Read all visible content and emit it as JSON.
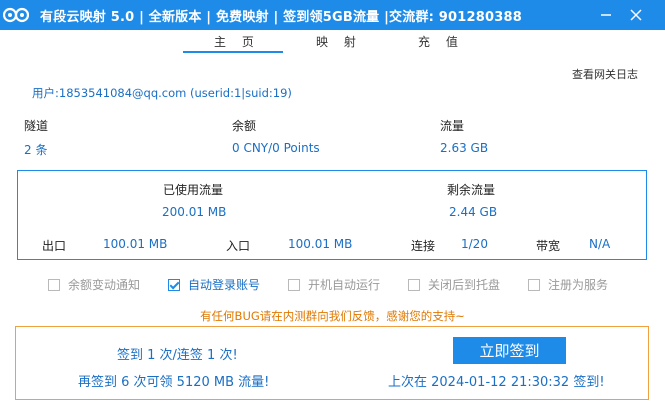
{
  "window": {
    "title": "有段云映射 5.0 | 全新版本 | 免费映射 | 签到领5GB流量 |交流群: 901280388",
    "minimize_icon": "minimize-icon",
    "close_icon": "close-icon",
    "logo_icon": "owl-logo-icon"
  },
  "tabs": [
    "主 页",
    "映 射",
    "充 值"
  ],
  "active_tab": "主 页",
  "header": {
    "log_link": "查看网关日志",
    "user_line": "用户:1853541084@qq.com (userid:1|suid:19)"
  },
  "stats": {
    "tunnels_label": "隧道",
    "tunnels_value": "2 条",
    "balance_label": "余额",
    "balance_value": "0 CNY/0 Points",
    "traffic_label": "流量",
    "traffic_value": "2.63 GB"
  },
  "traffic_box": {
    "used_label": "已使用流量",
    "used_value": "200.01 MB",
    "remaining_label": "剩余流量",
    "remaining_value": "2.44 GB",
    "out_label": "出口",
    "out_value": "100.01 MB",
    "in_label": "入口",
    "in_value": "100.01 MB",
    "conn_label": "连接",
    "conn_value": "1/20",
    "bandwidth_label": "带宽",
    "bandwidth_value": "N/A"
  },
  "options": [
    {
      "label": "余额变动通知",
      "checked": false
    },
    {
      "label": "自动登录账号",
      "checked": true
    },
    {
      "label": "开机自动运行",
      "checked": false
    },
    {
      "label": "关闭后到托盘",
      "checked": false
    },
    {
      "label": "注册为服务",
      "checked": false
    }
  ],
  "feedback": "有任何BUG请在内测群向我们反馈，感谢您的支持~",
  "signin": {
    "streak": "签到 1 次/连签 1 次!",
    "reward": "再签到 6 次可领 5120 MB 流量!",
    "button": "立即签到",
    "last": "上次在 2024-01-12 21:30:32 签到!"
  },
  "colors": {
    "accent": "#1e8be8",
    "value_text": "#1a6fc4",
    "warning": "#e07800"
  }
}
